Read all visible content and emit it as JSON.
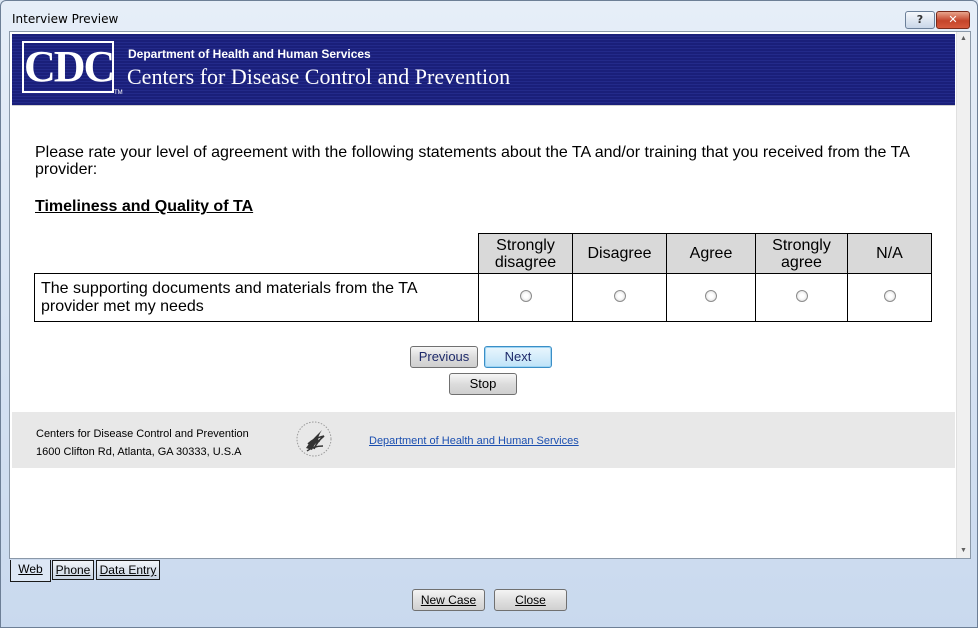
{
  "window": {
    "title": "Interview Preview",
    "help_label": "?",
    "close_label": "✕"
  },
  "banner": {
    "logo_text": "CDC",
    "trademark": "TM",
    "department": "Department of Health and Human Services",
    "agency": "Centers for Disease Control and Prevention"
  },
  "survey": {
    "question": "Please rate your level of agreement with the following statements about the TA and/or training that you received from the TA provider:",
    "section_title": "Timeliness and Quality of TA",
    "columns": [
      "Strongly disagree",
      "Disagree",
      "Agree",
      "Strongly agree",
      "N/A"
    ],
    "rows": [
      {
        "statement": "The supporting documents and materials from the TA provider met my needs"
      }
    ]
  },
  "nav": {
    "previous_label": "Previous",
    "next_label": "Next",
    "stop_label": "Stop"
  },
  "footer": {
    "org_name": "Centers for Disease Control and Prevention",
    "address": "1600 Clifton Rd, Atlanta, GA 30333, U.S.A",
    "hhs_link": "Department of Health and Human Services"
  },
  "tabs": {
    "web": "Web",
    "phone": "Phone",
    "data_entry": "Data Entry"
  },
  "actions": {
    "new_case": "New Case",
    "close": "Close"
  }
}
